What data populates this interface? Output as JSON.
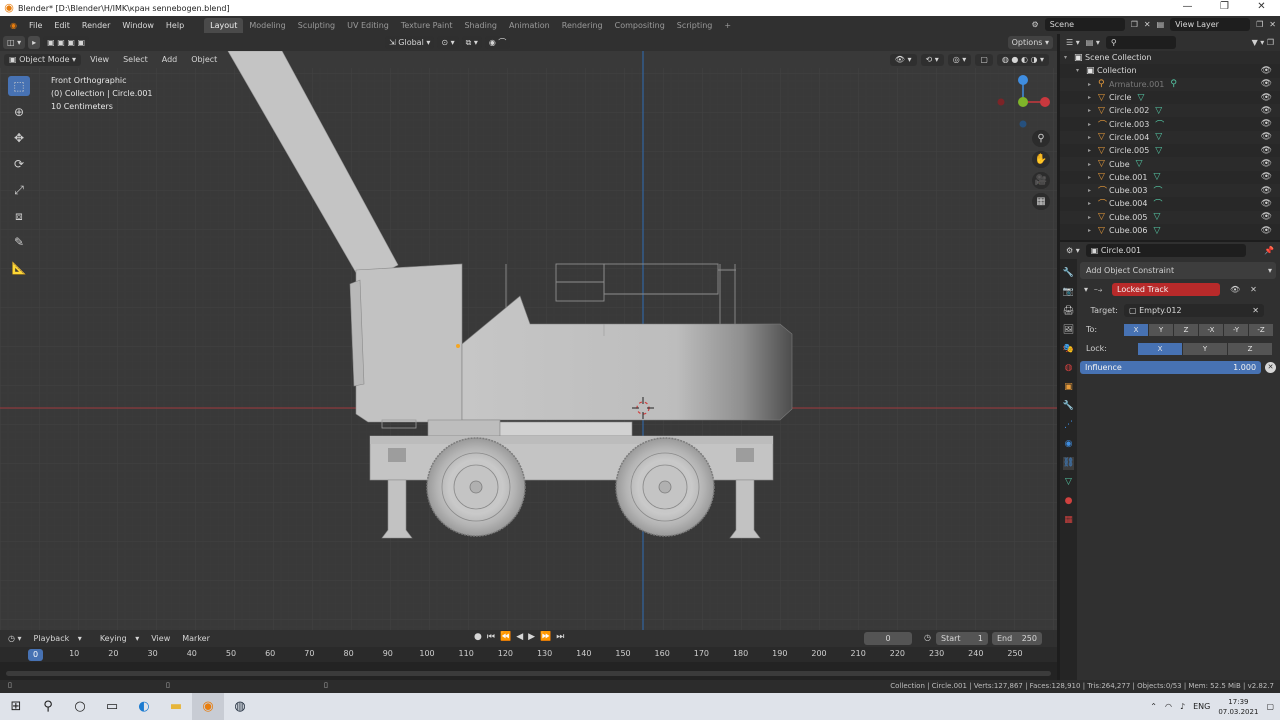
{
  "window": {
    "title": "Blender* [D:\\Blender\\H/IMK\\кран sennebogen.blend]",
    "app_icon": "blender-icon"
  },
  "menu": [
    "File",
    "Edit",
    "Render",
    "Window",
    "Help"
  ],
  "workspaces": [
    "Layout",
    "Modeling",
    "Sculpting",
    "UV Editing",
    "Texture Paint",
    "Shading",
    "Animation",
    "Rendering",
    "Compositing",
    "Scripting",
    "+"
  ],
  "active_workspace": "Layout",
  "scene": {
    "name": "Scene",
    "view_layer": "View Layer"
  },
  "viewport": {
    "transform_orientation": "Global",
    "options_label": "Options",
    "mode": "Object Mode",
    "menus": [
      "View",
      "Select",
      "Add",
      "Object"
    ],
    "info": [
      "Front Orthographic",
      "(0) Collection | Circle.001",
      "10 Centimeters"
    ]
  },
  "outliner": {
    "search_placeholder": "",
    "items": [
      {
        "label": "Scene Collection",
        "depth": 0,
        "icon": "collection-icon"
      },
      {
        "label": "Collection",
        "depth": 1,
        "icon": "collection-icon"
      },
      {
        "label": "Armature.001",
        "depth": 2,
        "icon": "armature-icon",
        "muted": true
      },
      {
        "label": "Circle",
        "depth": 2,
        "icon": "mesh-icon"
      },
      {
        "label": "Circle.002",
        "depth": 2,
        "icon": "mesh-icon"
      },
      {
        "label": "Circle.003",
        "depth": 2,
        "icon": "curve-icon"
      },
      {
        "label": "Circle.004",
        "depth": 2,
        "icon": "mesh-icon"
      },
      {
        "label": "Circle.005",
        "depth": 2,
        "icon": "mesh-icon"
      },
      {
        "label": "Cube",
        "depth": 2,
        "icon": "mesh-icon"
      },
      {
        "label": "Cube.001",
        "depth": 2,
        "icon": "mesh-icon"
      },
      {
        "label": "Cube.003",
        "depth": 2,
        "icon": "curve-icon"
      },
      {
        "label": "Cube.004",
        "depth": 2,
        "icon": "curve-icon"
      },
      {
        "label": "Cube.005",
        "depth": 2,
        "icon": "mesh-icon"
      },
      {
        "label": "Cube.006",
        "depth": 2,
        "icon": "mesh-icon"
      }
    ]
  },
  "properties": {
    "object_name": "Circle.001",
    "add_constraint_label": "Add Object Constraint",
    "constraint": {
      "name": "Locked Track",
      "target_label": "Target:",
      "target_value": "Empty.012",
      "to_label": "To:",
      "to_options": [
        "X",
        "Y",
        "Z",
        "-X",
        "-Y",
        "-Z"
      ],
      "to_active": "X",
      "lock_label": "Lock:",
      "lock_options": [
        "X",
        "Y",
        "Z"
      ],
      "lock_active": "X",
      "influence_label": "Influence",
      "influence_value": "1.000"
    }
  },
  "timeline": {
    "menus": [
      "Playback",
      "Keying",
      "View",
      "Marker"
    ],
    "current_frame": "0",
    "start_label": "Start",
    "start_value": "1",
    "end_label": "End",
    "end_value": "250",
    "ticks": [
      "0",
      "10",
      "20",
      "30",
      "40",
      "50",
      "60",
      "70",
      "80",
      "90",
      "100",
      "110",
      "120",
      "130",
      "140",
      "150",
      "160",
      "170",
      "180",
      "190",
      "200",
      "210",
      "220",
      "230",
      "240",
      "250"
    ]
  },
  "statusbar": {
    "stats": "Collection | Circle.001 | Verts:127,867 | Faces:128,910 | Tris:264,277 | Objects:0/53 | Mem: 52.5 MiB | v2.82.7"
  },
  "taskbar": {
    "lang": "ENG",
    "time": "17:39",
    "date": "07.03.2021"
  },
  "colors": {
    "accent": "#4772b3",
    "constraint_red": "#b82a2a",
    "x_axis": "#c9383e",
    "y_axis": "#7fb52a",
    "z_axis": "#3f8de0"
  }
}
